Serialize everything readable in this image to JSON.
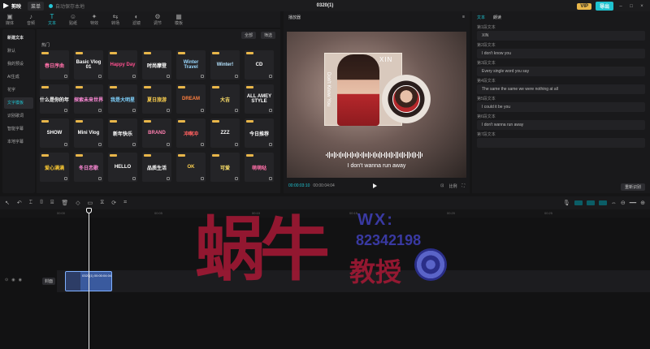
{
  "titlebar": {
    "app_name": "剪映",
    "menu_label": "菜单",
    "project_status": "自动保存本地",
    "title": "0320(1)",
    "vip": "VIP",
    "export": "导出"
  },
  "toolbar": {
    "tools": [
      {
        "label": "媒体",
        "icon": "media-icon"
      },
      {
        "label": "音频",
        "icon": "audio-icon"
      },
      {
        "label": "文本",
        "icon": "text-icon",
        "active": true
      },
      {
        "label": "贴纸",
        "icon": "sticker-icon"
      },
      {
        "label": "特效",
        "icon": "effects-icon"
      },
      {
        "label": "转场",
        "icon": "transition-icon"
      },
      {
        "label": "滤镜",
        "icon": "filter-icon"
      },
      {
        "label": "调节",
        "icon": "adjust-icon"
      },
      {
        "label": "模板",
        "icon": "template-icon"
      }
    ]
  },
  "sidebar": {
    "items": [
      {
        "label": "新建文本",
        "head": true
      },
      {
        "label": "默认"
      },
      {
        "label": "我的预设"
      },
      {
        "label": "AI生成"
      },
      {
        "label": "花字"
      },
      {
        "label": "文字模板",
        "active": true
      },
      {
        "label": "识别歌词"
      },
      {
        "label": "智能字幕"
      },
      {
        "label": "本地字幕"
      }
    ]
  },
  "assets": {
    "filter_label": "全部",
    "filter2_label": "筛选",
    "section": "热门",
    "tiles": [
      {
        "text": "春日序曲",
        "color": "#ff6fa8"
      },
      {
        "text": "Basic Vlog 01",
        "color": "#ffffff"
      },
      {
        "text": "Happy Day",
        "color": "#ff4f8f"
      },
      {
        "text": "时尚摩登",
        "color": "#ffffff"
      },
      {
        "text": "Winter Travel",
        "color": "#9ad8ff"
      },
      {
        "text": "Winter!",
        "color": "#b5e3ff"
      },
      {
        "text": "CD",
        "color": "#ffffff"
      },
      {
        "text": "什么是你的年",
        "color": "#ffffff"
      },
      {
        "text": "探索未来世界",
        "color": "#ff8ad8"
      },
      {
        "text": "我是大明星",
        "color": "#7fd3ff"
      },
      {
        "text": "夏日旅游",
        "color": "#ffd24f"
      },
      {
        "text": "DREAM",
        "color": "#ff7f3f"
      },
      {
        "text": "大吉",
        "color": "#ffe16a"
      },
      {
        "text": "ALL AMEY STYLE",
        "color": "#ffffff"
      },
      {
        "text": "SHOW",
        "color": "#ffffff"
      },
      {
        "text": "Mini Vlog",
        "color": "#ffffff"
      },
      {
        "text": "新年快乐",
        "color": "#ffffff"
      },
      {
        "text": "BRAND",
        "color": "#ff7fb0"
      },
      {
        "text": "冲啊冲",
        "color": "#ff5f5f"
      },
      {
        "text": "ZZZ",
        "color": "#ffffff"
      },
      {
        "text": "今日推荐",
        "color": "#ffffff"
      },
      {
        "text": "爱心满满",
        "color": "#ffcc33"
      },
      {
        "text": "冬日恋歌",
        "color": "#ff8ad8"
      },
      {
        "text": "HELLO",
        "color": "#ffffff"
      },
      {
        "text": "品质生活",
        "color": "#ffffff"
      },
      {
        "text": "OK",
        "color": "#ffd24f"
      },
      {
        "text": "可爱",
        "color": "#ffe36a"
      },
      {
        "text": "萌萌哒",
        "color": "#ff6fa8"
      }
    ]
  },
  "player": {
    "title": "播放器",
    "time_current": "00:00:03:10",
    "time_total": "00:00:04:04",
    "ratio_label": "比例",
    "overlay_xin": "XIN",
    "overlay_vertical": "Don't Know You",
    "caption": "I don't wanna run away"
  },
  "rpanel": {
    "tabs": [
      {
        "label": "文本",
        "active": true
      },
      {
        "label": "朗读"
      }
    ],
    "subtitles": [
      {
        "label": "第1段文本",
        "value": "XIN"
      },
      {
        "label": "第2段文本",
        "value": "I don't know you"
      },
      {
        "label": "第3段文本",
        "value": "Every single word you say"
      },
      {
        "label": "第4段文本",
        "value": "The same the same we were nothing at all"
      },
      {
        "label": "第5段文本",
        "value": "I could it be you"
      },
      {
        "label": "第6段文本",
        "value": "I don't wanna run away"
      },
      {
        "label": "第7段文本",
        "value": ""
      }
    ],
    "footer_btn": "重新识别"
  },
  "timeline": {
    "ruler": [
      "00:00",
      "00:05",
      "00:10",
      "00:15",
      "00:20",
      "00:25"
    ],
    "cover_label": "封面",
    "clip_label": "0320(1) 00:00:04:04"
  },
  "watermark": {
    "big": "蜗牛",
    "wx": "WX:",
    "number": "82342198",
    "sub": "教授"
  }
}
